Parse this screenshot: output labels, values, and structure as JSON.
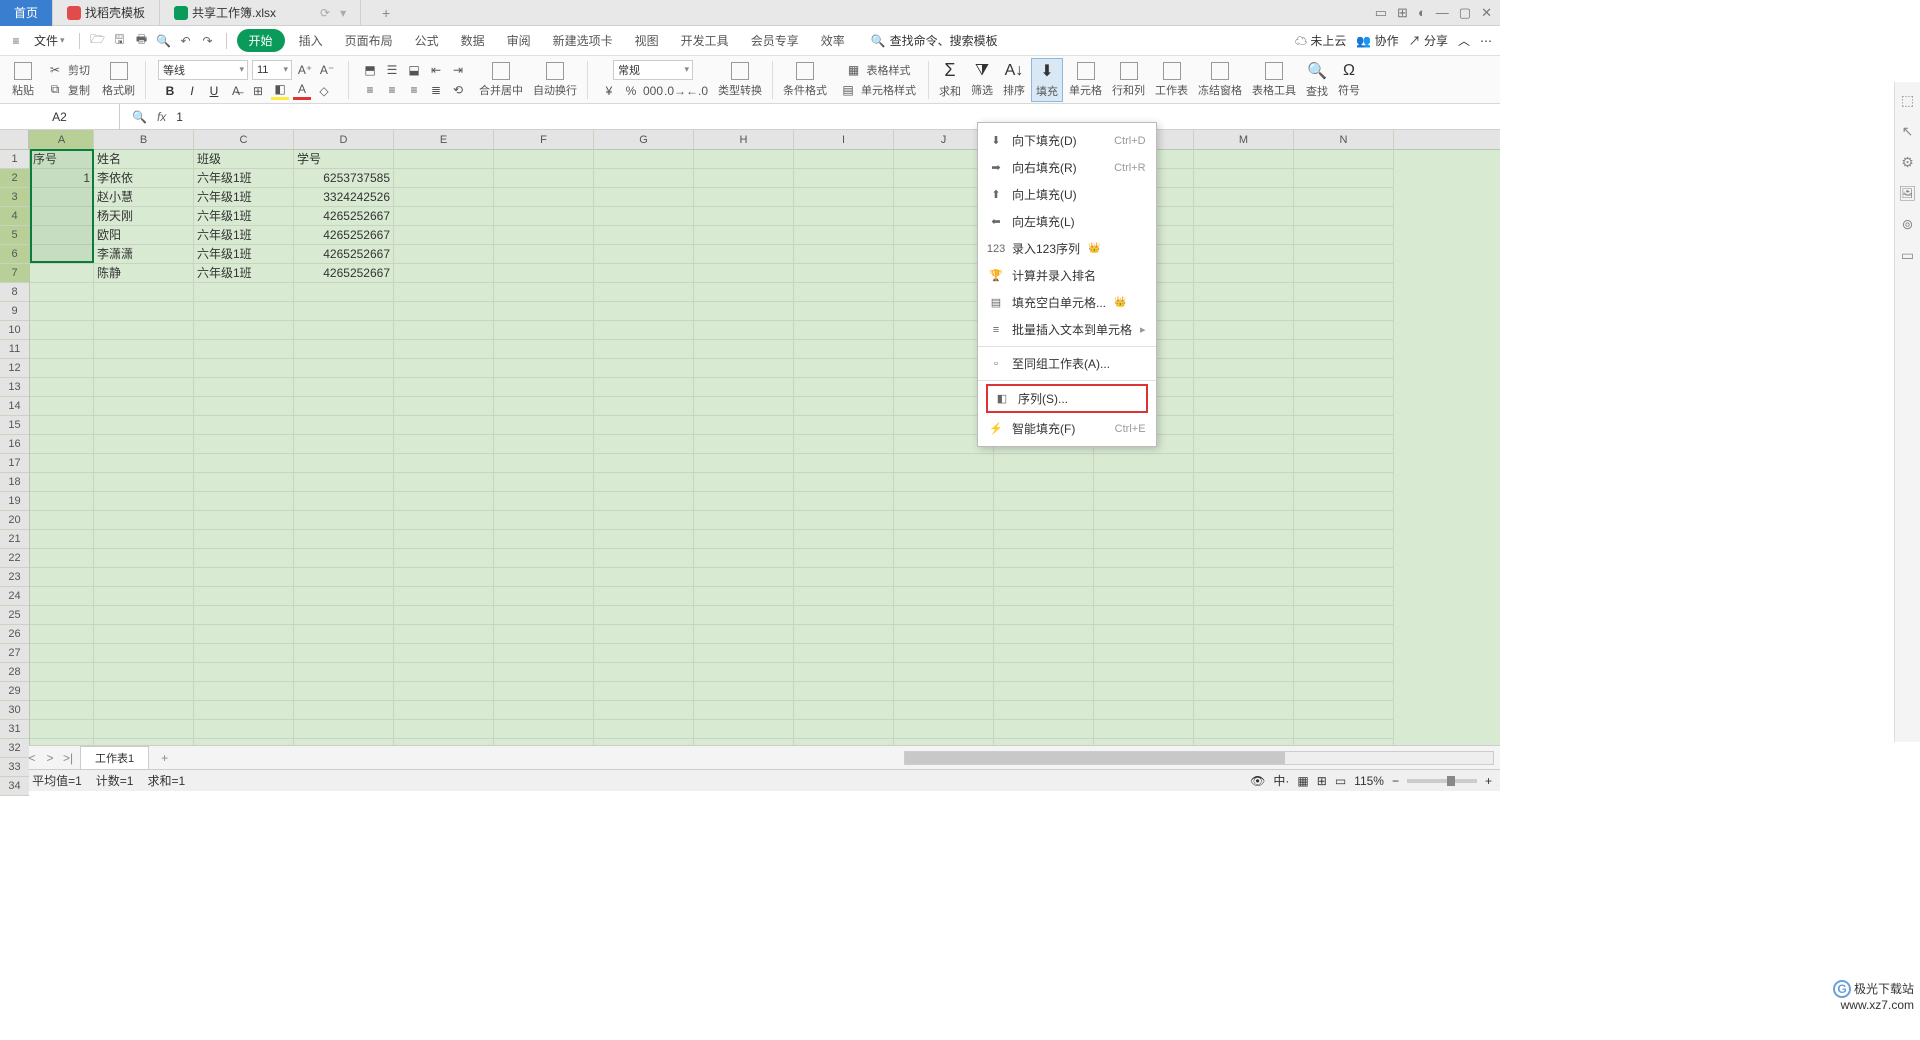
{
  "titlebar": {
    "home": "首页",
    "tab2": "找稻壳模板",
    "tab3": "共享工作簿.xlsx"
  },
  "menubar": {
    "file": "文件",
    "tabs": [
      "开始",
      "插入",
      "页面布局",
      "公式",
      "数据",
      "审阅",
      "新建选项卡",
      "视图",
      "开发工具",
      "会员专享",
      "效率"
    ],
    "search_ph": "查找命令、搜索模板",
    "cloud": "未上云",
    "coop": "协作",
    "share": "分享"
  },
  "ribbon": {
    "paste": "粘贴",
    "cut": "剪切",
    "copy": "复制",
    "brush": "格式刷",
    "font_name": "等线",
    "font_size": "11",
    "merge": "合并居中",
    "wrap": "自动换行",
    "numfmt": "常规",
    "type": "类型转换",
    "cond": "条件格式",
    "tablestyle": "表格样式",
    "cellstyle": "单元格样式",
    "sum": "求和",
    "filter": "筛选",
    "sort": "排序",
    "fill": "填充",
    "cell": "单元格",
    "rowcol": "行和列",
    "sheet": "工作表",
    "freeze": "冻结窗格",
    "tabletool": "表格工具",
    "find": "查找",
    "symbol": "符号"
  },
  "namebox": {
    "ref": "A2",
    "formula": "1"
  },
  "columns": [
    "A",
    "B",
    "C",
    "D",
    "E",
    "F",
    "G",
    "H",
    "I",
    "J",
    "K",
    "L",
    "M",
    "N"
  ],
  "rows_count": 34,
  "headers": [
    "序号",
    "姓名",
    "班级",
    "学号"
  ],
  "data": [
    {
      "a": "1",
      "b": "李依依",
      "c": "六年级1班",
      "d": "6253737585"
    },
    {
      "a": "",
      "b": "赵小慧",
      "c": "六年级1班",
      "d": "3324242526"
    },
    {
      "a": "",
      "b": "杨天刚",
      "c": "六年级1班",
      "d": "4265252667"
    },
    {
      "a": "",
      "b": "欧阳",
      "c": "六年级1班",
      "d": "4265252667"
    },
    {
      "a": "",
      "b": "李潇潇",
      "c": "六年级1班",
      "d": "4265252667"
    },
    {
      "a": "",
      "b": "陈静",
      "c": "六年级1班",
      "d": "4265252667"
    }
  ],
  "dropdown": {
    "items": [
      {
        "label": "向下填充(D)",
        "sc": "Ctrl+D"
      },
      {
        "label": "向右填充(R)",
        "sc": "Ctrl+R"
      },
      {
        "label": "向上填充(U)",
        "sc": ""
      },
      {
        "label": "向左填充(L)",
        "sc": ""
      },
      {
        "label": "录入123序列",
        "sc": "",
        "premium": true
      },
      {
        "label": "计算并录入排名",
        "sc": ""
      },
      {
        "label": "填充空白单元格...",
        "sc": "",
        "premium": true
      },
      {
        "label": "批量插入文本到单元格",
        "sc": "",
        "arrow": true
      },
      {
        "label": "至同组工作表(A)...",
        "sc": "",
        "disabled": true
      },
      {
        "label": "序列(S)...",
        "sc": "",
        "boxed": true
      },
      {
        "label": "智能填充(F)",
        "sc": "Ctrl+E"
      }
    ]
  },
  "sheet": {
    "name": "工作表1"
  },
  "status": {
    "avg": "平均值=1",
    "count": "计数=1",
    "sum": "求和=1",
    "zoom": "115%"
  },
  "watermark": {
    "line1": "极光下载站",
    "line2": "www.xz7.com"
  }
}
